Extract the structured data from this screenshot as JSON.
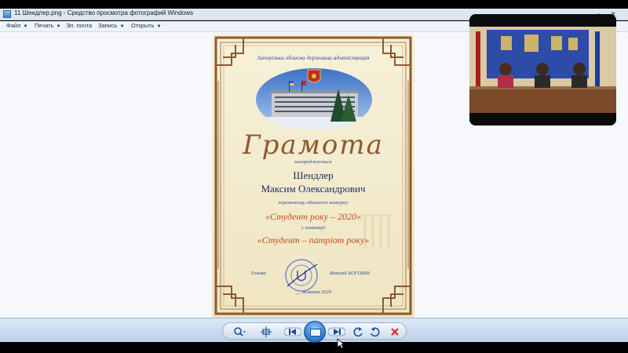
{
  "window": {
    "title": "11 Шендлер.png - Средство просмотра фотографий Windows"
  },
  "menu": {
    "items": [
      {
        "label": "Файл",
        "caret": "▼"
      },
      {
        "label": "Печать",
        "caret": "▼"
      },
      {
        "label": "Эл. почта",
        "caret": ""
      },
      {
        "label": "Запись",
        "caret": "▼"
      },
      {
        "label": "Открыть",
        "caret": "▼"
      }
    ]
  },
  "certificate": {
    "org": "Запорізька обласна державна адміністрація",
    "heading": "Грамота",
    "award_text": "нагороджується",
    "surname": "Шендлер",
    "full_name": "Максим Олександрович",
    "winner_text": "переможець обласного конкурсу",
    "contest": "«Студент року – 2020»",
    "nomination_label": "у номінації",
    "nomination": "«Студент – патріот року»",
    "signer_title": "Голова",
    "signer_name": "Віталій БОГОВІН",
    "date": "__ жовтня 2020"
  },
  "colors": {
    "titlebar": "#dfe6ef",
    "viewer_bg": "#f6f8fb",
    "toolbar": "#bcd0e9",
    "frame_brown": "#8d5a30"
  },
  "icons": [
    "app-icon",
    "minimize-icon",
    "maximize-icon",
    "close-icon",
    "zoom-icon",
    "fit-window-icon",
    "previous-icon",
    "slideshow-icon",
    "next-icon",
    "rotate-ccw-icon",
    "rotate-cw-icon",
    "delete-icon"
  ]
}
